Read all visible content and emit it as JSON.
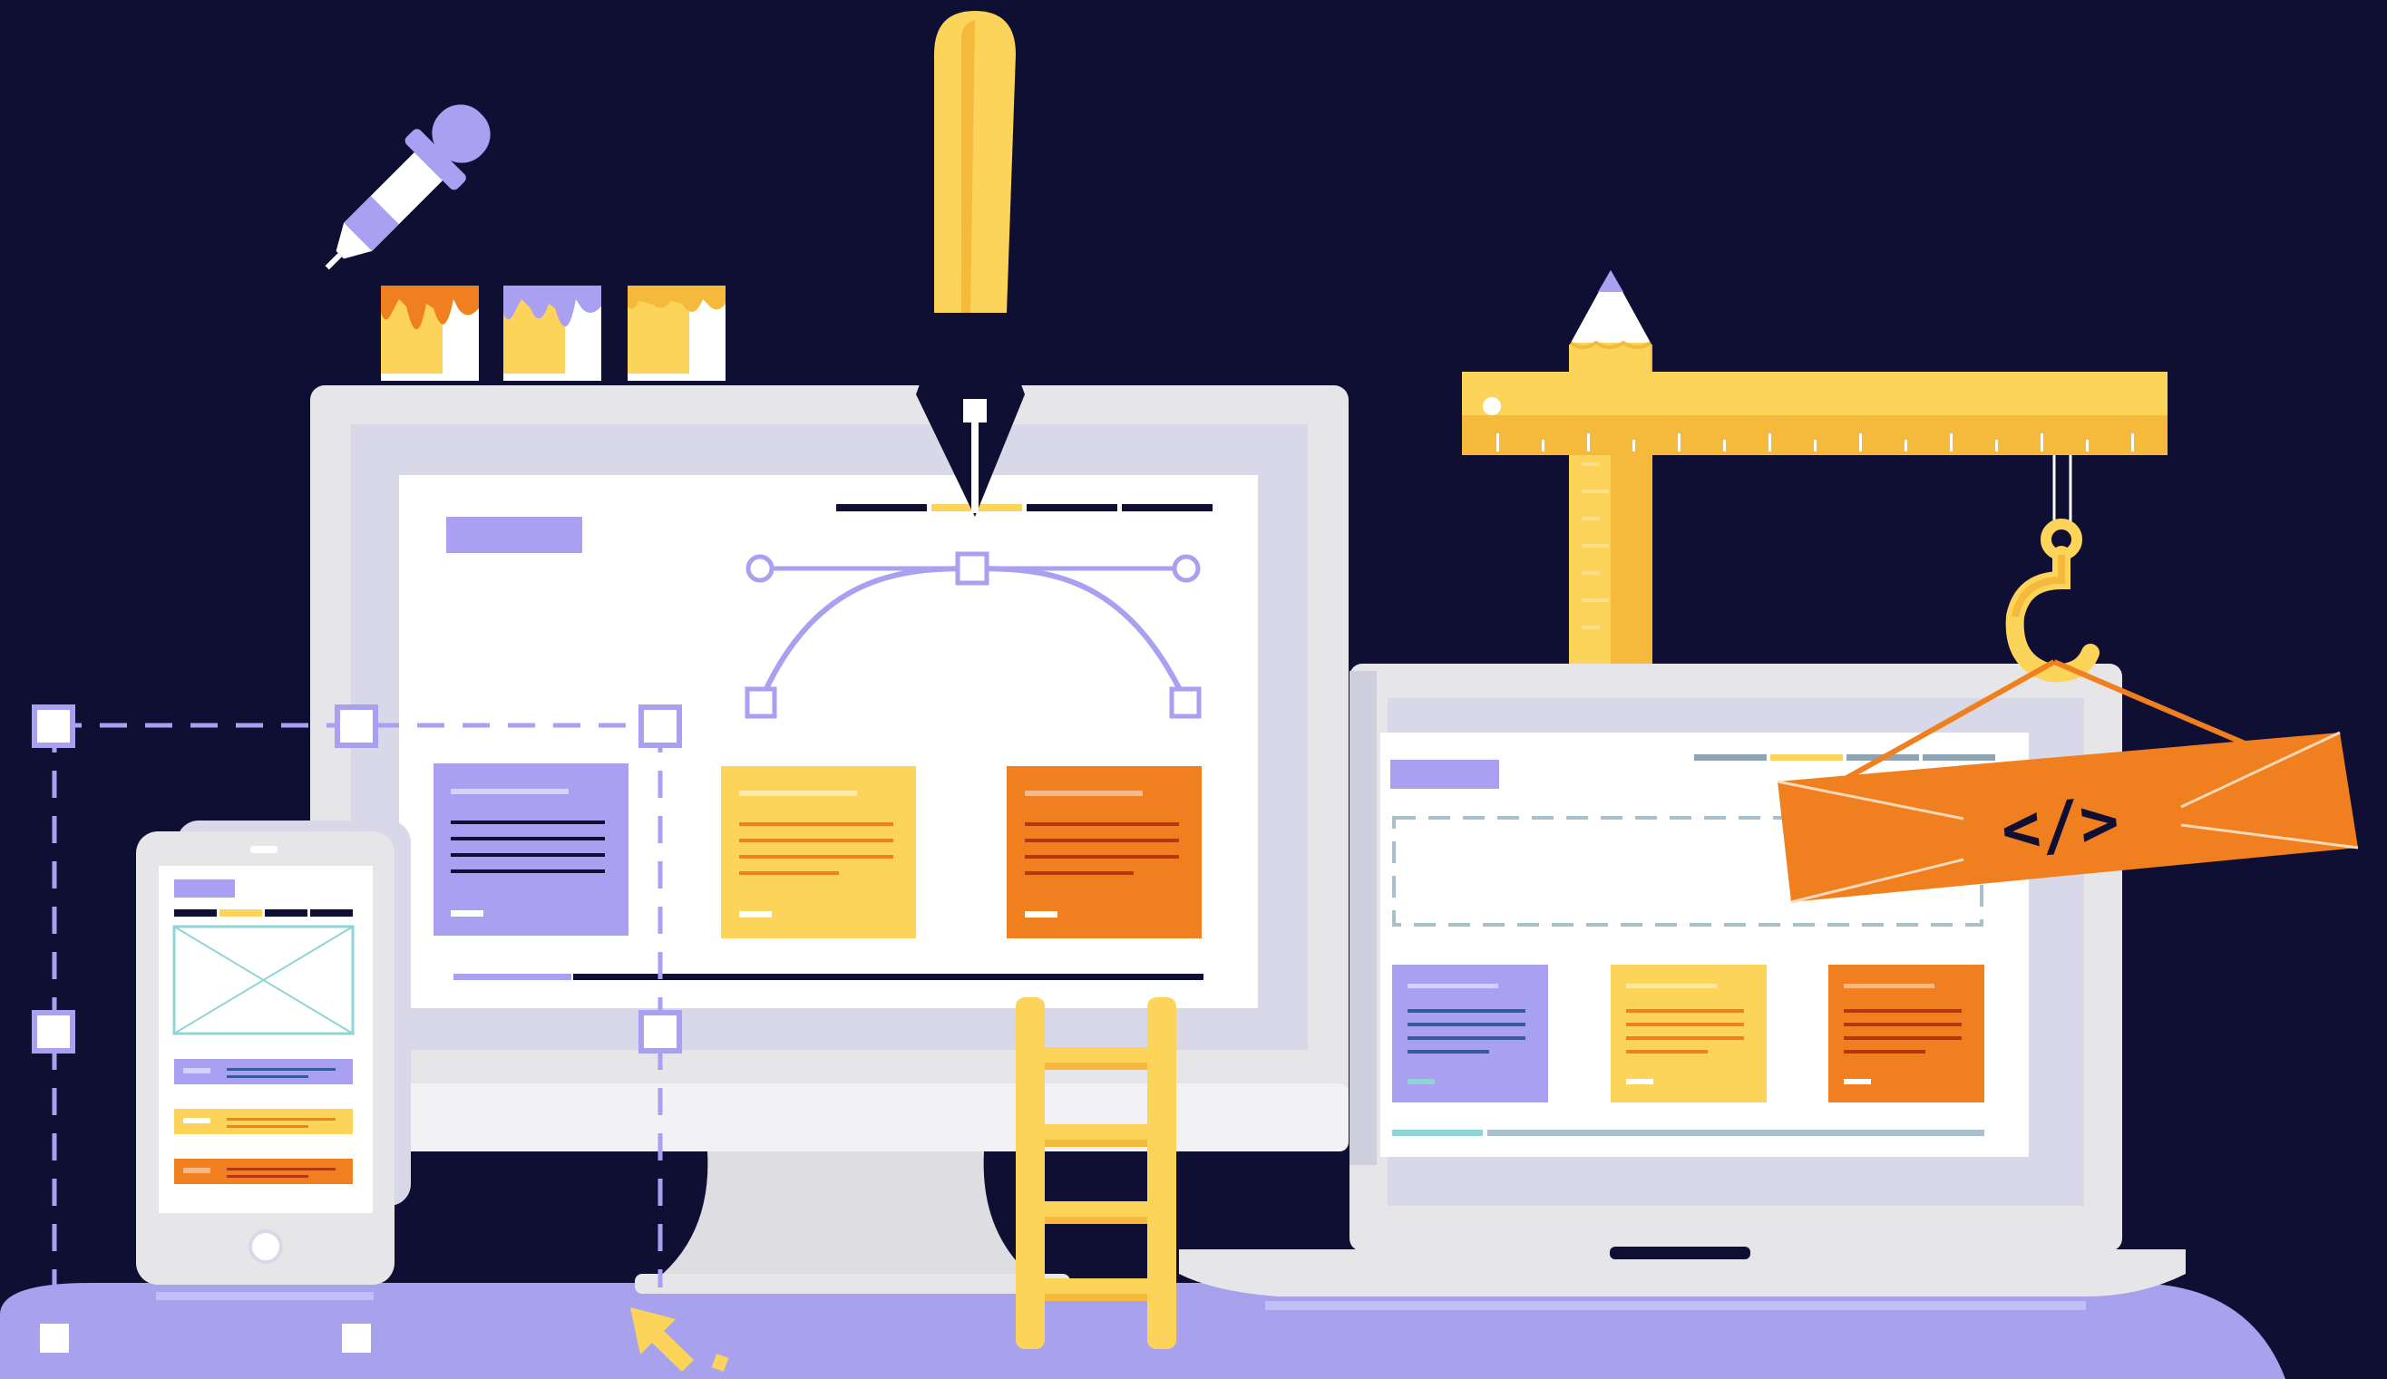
{
  "illustration": {
    "code_sign": "</>"
  },
  "colors": {
    "background": "#0e0f33",
    "ground": "#a8a2ee",
    "purple": "#aaa0f2",
    "purple_dark": "#8f84e6",
    "yellow": "#fdd45a",
    "yellow_dark": "#f5b93b",
    "orange": "#f07f1f",
    "orange_dark": "#c9541a",
    "screen_bezel": "#e6e6e8",
    "screen_inner": "#d9d8e8",
    "white": "#ffffff",
    "navy": "#0e0f33",
    "teal": "#8fd5d6",
    "steel": "#8fa4b3"
  },
  "objects": [
    "paint-bucket-orange",
    "paint-bucket-purple",
    "paint-bucket-yellow",
    "eyedropper-icon",
    "pen-tool-icon",
    "pencil-icon",
    "ruler-crane",
    "crane-hook-icon",
    "code-sign",
    "desktop-monitor",
    "laptop",
    "smartphone",
    "ladder",
    "selection-box",
    "cursor-arrow-icon"
  ]
}
